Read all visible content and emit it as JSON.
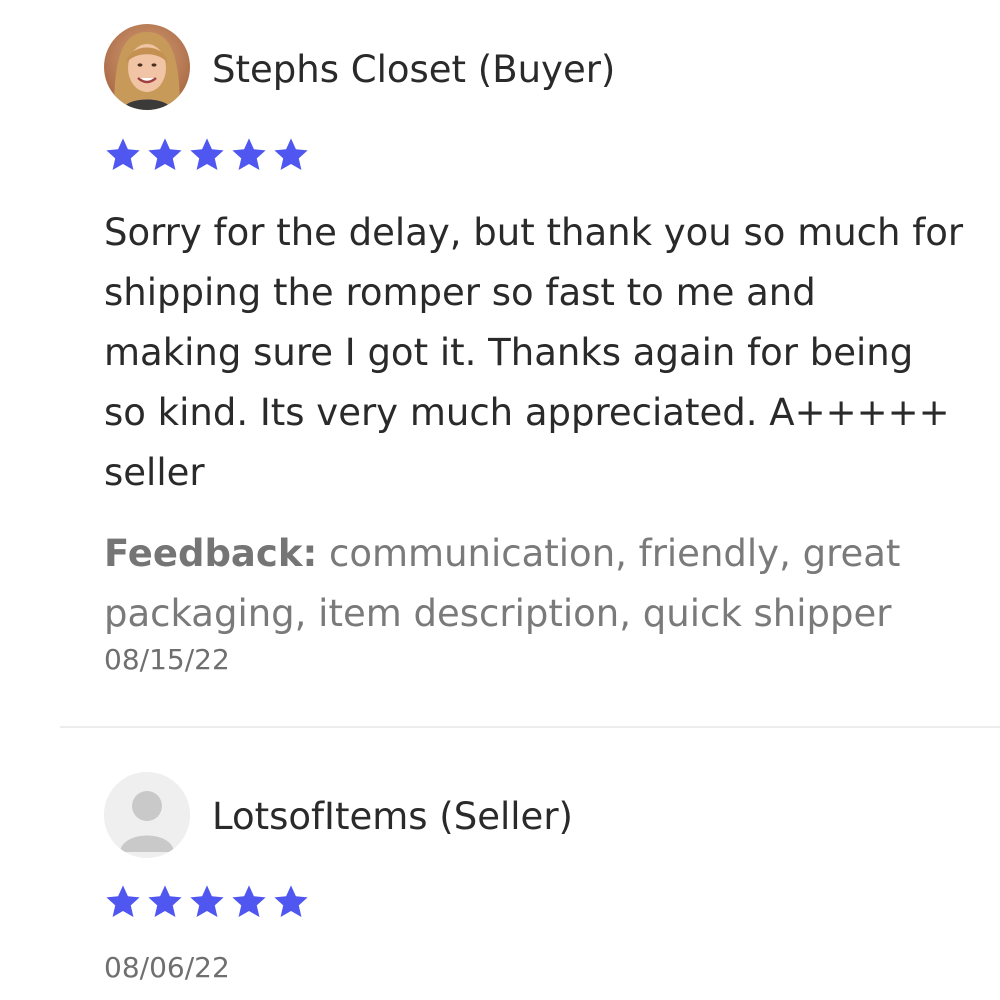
{
  "reviews": [
    {
      "author": "Stephs Closet (Buyer)",
      "rating": 5,
      "comment": "Sorry for the delay, but thank you so much for shipping the romper so fast to me and making sure I got it. Thanks again for being so kind. Its very much appreciated. A+++++ seller",
      "feedback_label": "Feedback:",
      "feedback_tags": " communication, friendly, great packaging, item description, quick shipper",
      "date": "08/15/22",
      "avatar": "user-photo"
    },
    {
      "author": "LotsofItems (Seller)",
      "rating": 5,
      "date": "08/06/22",
      "avatar": "default-user-icon"
    }
  ],
  "colors": {
    "star": "#5056f0",
    "divider": "#ececec"
  },
  "icons": {
    "star": "star-icon",
    "default_avatar": "user-placeholder-icon"
  }
}
